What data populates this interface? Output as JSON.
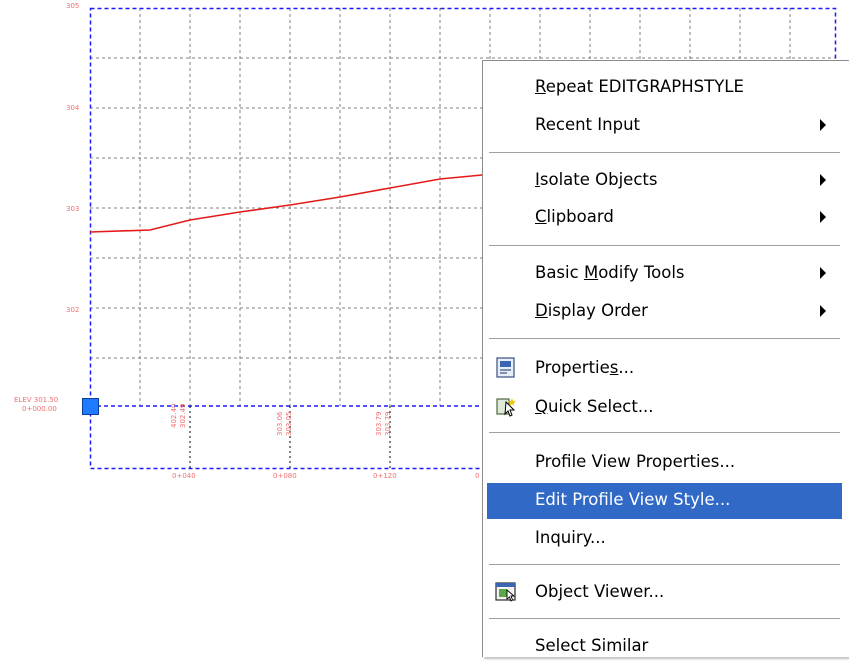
{
  "profile_view": {
    "elevation_labels": [
      "305",
      "304",
      "303",
      "302"
    ],
    "datum_label": [
      "ELEV 301.50",
      "0+000.00"
    ],
    "station_labels": [
      "0+040",
      "0+080",
      "0+120",
      "0"
    ],
    "vertical_data_labels": [
      [
        "402.40",
        "302.49"
      ],
      [
        "303.06",
        "303.05"
      ],
      [
        "303.79",
        "303.79"
      ]
    ],
    "colors": {
      "grid": "#808080",
      "frame": "#1a1aff",
      "profile_line": "#e41a1a",
      "labels": "#f07070",
      "grip": "#1e7bff"
    }
  },
  "context_menu": {
    "items": [
      {
        "label": "Repeat EDITGRAPHSTYLE",
        "underline": "R",
        "submenu": false,
        "icon": ""
      },
      {
        "label": "Recent Input",
        "underline": "",
        "submenu": true,
        "icon": ""
      },
      {
        "label": "Isolate Objects",
        "underline": "I",
        "submenu": true,
        "icon": ""
      },
      {
        "label": "Clipboard",
        "underline": "C",
        "submenu": true,
        "icon": ""
      },
      {
        "label": "Basic Modify Tools",
        "underline": "M",
        "submenu": true,
        "icon": ""
      },
      {
        "label": "Display Order",
        "underline": "D",
        "submenu": true,
        "icon": ""
      },
      {
        "label": "Properties...",
        "underline": "s",
        "submenu": false,
        "icon": "properties-icon"
      },
      {
        "label": "Quick Select...",
        "underline": "Q",
        "submenu": false,
        "icon": "quick-select-icon"
      },
      {
        "label": "Profile View Properties...",
        "underline": "",
        "submenu": false,
        "icon": ""
      },
      {
        "label": "Edit Profile View Style...",
        "underline": "",
        "submenu": false,
        "icon": "",
        "highlighted": true
      },
      {
        "label": "Inquiry...",
        "underline": "",
        "submenu": false,
        "icon": ""
      },
      {
        "label": "Object Viewer...",
        "underline": "",
        "submenu": false,
        "icon": "object-viewer-icon"
      },
      {
        "label": "Select Similar",
        "underline": "",
        "submenu": false,
        "icon": ""
      }
    ]
  }
}
